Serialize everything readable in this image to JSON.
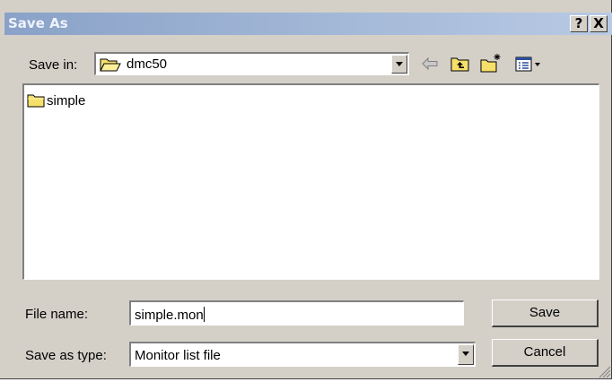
{
  "window": {
    "title": "Save As",
    "help_label": "?",
    "close_label": "X"
  },
  "save_in": {
    "label": "Save in:",
    "value": "dmc50"
  },
  "toolbar": {
    "back_icon": "back-arrow-icon",
    "up_icon": "up-one-level-icon",
    "new_folder_icon": "new-folder-icon",
    "views_icon": "view-menu-icon"
  },
  "files": [
    {
      "name": "simple",
      "type": "folder"
    }
  ],
  "file_name": {
    "label": "File name:",
    "value": "simple.mon"
  },
  "save_as_type": {
    "label": "Save as type:",
    "value": "Monitor list file"
  },
  "buttons": {
    "save": "Save",
    "cancel": "Cancel"
  },
  "colors": {
    "dialog_bg": "#d4d0c8",
    "titlebar_start": "#8aa2c8",
    "titlebar_end": "#b8cae4",
    "folder_yellow": "#f6e06a"
  }
}
